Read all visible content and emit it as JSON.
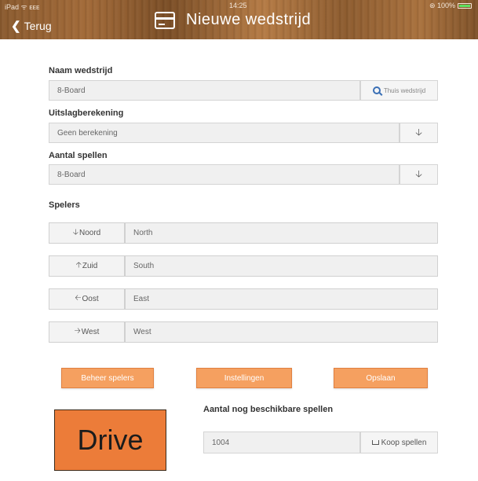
{
  "status_bar": {
    "left": "iPad ᯤ ᴇᴇᴇ",
    "time": "14:25",
    "battery": "⊛ 100%"
  },
  "nav": {
    "back_label": "Terug",
    "title": "Nieuwe wedstrijd",
    "title_icon": "credit-card-icon"
  },
  "form": {
    "name": {
      "label": "Naam wedstrijd",
      "value": "8-Board",
      "search_label": "Thuis wedstrijd",
      "search_icon": "search-icon"
    },
    "result_calc": {
      "label": "Uitslagberekening",
      "value": "Geen berekening",
      "dropdown_icon": "arrow-down-icon"
    },
    "games_count": {
      "label": "Aantal spellen",
      "value": "8-Board",
      "dropdown_icon": "arrow-down-icon"
    }
  },
  "players": {
    "label": "Spelers",
    "rows": [
      {
        "direction_arrow": "🡣",
        "direction": "Noord",
        "value": "North"
      },
      {
        "direction_arrow": "🡡",
        "direction": "Zuid",
        "value": "South"
      },
      {
        "direction_arrow": "🡠",
        "direction": "Oost",
        "value": "East"
      },
      {
        "direction_arrow": "🡢",
        "direction": "West",
        "value": "West"
      }
    ]
  },
  "actions": {
    "manage_players": "Beheer spelers",
    "settings": "Instellingen",
    "save": "Opslaan"
  },
  "remaining": {
    "label": "Aantal nog beschikbare spellen",
    "value": "1004",
    "buy_label": "Koop spellen",
    "buy_icon": "cart-icon"
  },
  "logo": {
    "text": "Drive"
  },
  "colors": {
    "accent": "#f5a060",
    "logo_bg": "#ec7c39",
    "header_wood": "#8a5a2e",
    "search_icon": "#3a6fb5"
  }
}
